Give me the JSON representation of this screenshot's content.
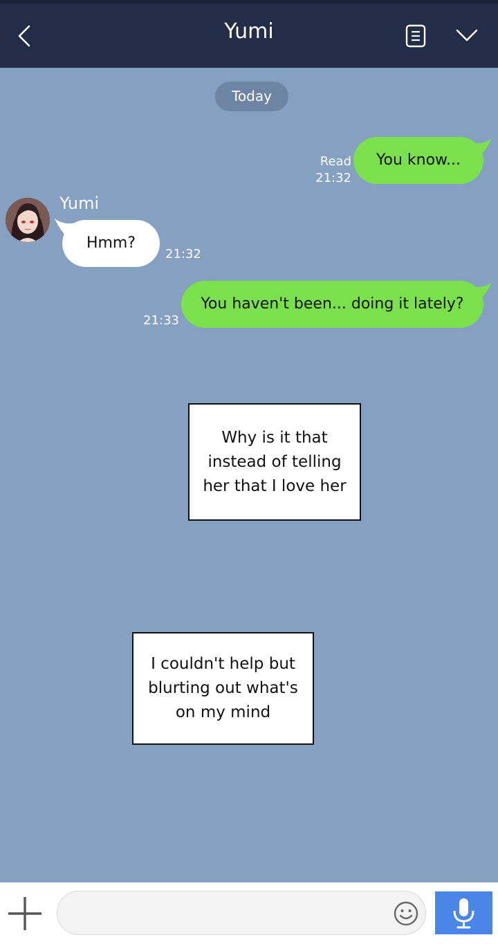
{
  "header": {
    "title": "Yumi",
    "back_icon": "chevron-left-icon",
    "notes_icon": "notes-icon",
    "menu_icon": "chevron-down-icon",
    "background": "#232d47"
  },
  "chat": {
    "date_label": "Today",
    "background": "#85a0c1",
    "messages": [
      {
        "direction": "out",
        "text": "You know...",
        "status": "Read",
        "time": "21:32"
      },
      {
        "direction": "in",
        "sender": "Yumi",
        "text": "Hmm?",
        "time": "21:32"
      },
      {
        "direction": "out",
        "text": "You haven't been... doing it lately?",
        "time": "21:33"
      }
    ]
  },
  "narration": [
    {
      "text": "Why is it that instead of telling her that I love her"
    },
    {
      "text": "I couldn't help but blurting out what's on my mind"
    }
  ],
  "composer": {
    "input_value": "",
    "plus_icon": "plus-icon",
    "emoji_icon": "emoji-icon",
    "mic_icon": "microphone-icon",
    "mic_color": "#4a86e8"
  },
  "colors": {
    "outgoing_bubble": "#7ae04c",
    "incoming_bubble": "#ffffff"
  }
}
